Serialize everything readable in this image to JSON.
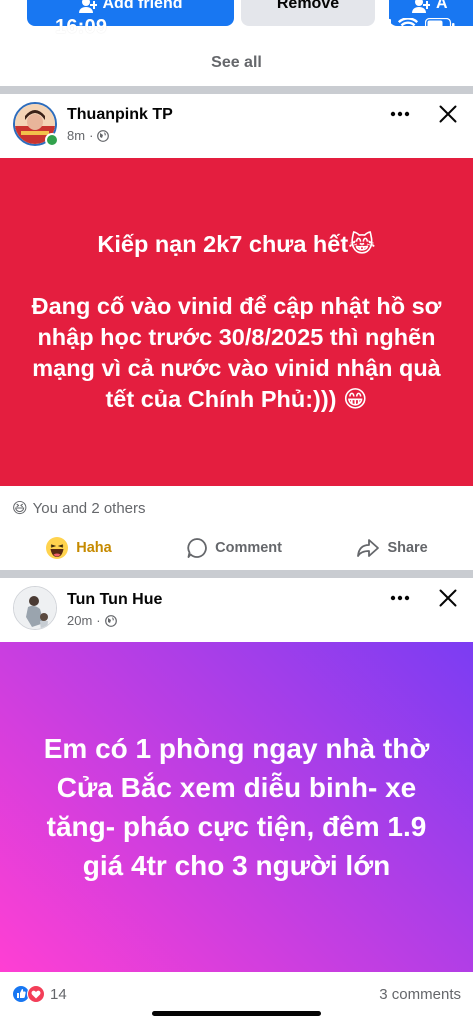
{
  "status_bar": {
    "time": "16:09"
  },
  "top_strip": {
    "add_friend_label": "Add friend",
    "remove_label": "Remove",
    "third_label": "A",
    "see_all": "See all"
  },
  "posts": [
    {
      "author": "Thuanpink TP",
      "time": "8m",
      "privacy_icon": "globe-icon",
      "online": true,
      "background": "#e41e3f",
      "text": "Kiếp nạn 2k7 chưa hết😹\n\nĐang cố vào vinid để cập nhật hồ sơ nhập học trước 30/8/2025 thì nghẽn mạng vì cả nước vào vinid nhận quà tết của Chính Phủ:))) 😁",
      "reactions": {
        "emoji": "😆",
        "label": "You and 2 others"
      },
      "actions": {
        "reaction_label": "Haha",
        "comment_label": "Comment",
        "share_label": "Share"
      }
    },
    {
      "author": "Tun Tun Hue",
      "time": "20m",
      "privacy_icon": "globe-icon",
      "online": false,
      "background_gradient": [
        "#ff3fd3",
        "#7b3df3"
      ],
      "text": "Em có 1 phòng ngay nhà thờ Cửa Bắc xem diễu binh- xe tăng- pháo cực tiện, đêm 1.9 giá 4tr cho 3 người lớn",
      "reactions": {
        "icons": [
          "like-icon",
          "love-icon"
        ],
        "count": "14",
        "comments": "3 comments"
      }
    }
  ],
  "colors": {
    "accent": "#1877f2",
    "secondary_text": "#65676b",
    "online": "#31a24c"
  }
}
